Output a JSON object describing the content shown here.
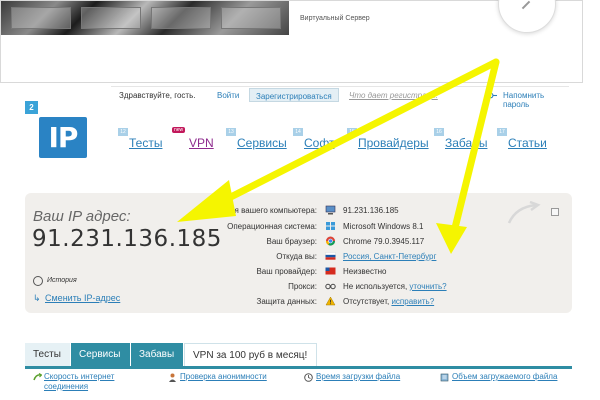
{
  "ad": {
    "caption": "Виртуальный Сервер"
  },
  "login_bar": {
    "greeting": "Здравствуйте, гость.",
    "login": "Войти",
    "register": "Зарегистрироваться",
    "what_gives": "Что дает регистрац...",
    "remind_password": "Напомнить пароль"
  },
  "logo": {
    "badge": "2",
    "text": "IP"
  },
  "nav": {
    "items": [
      {
        "label": "Тесты",
        "num": "12"
      },
      {
        "label": "VPN",
        "num": "",
        "badge": "new"
      },
      {
        "label": "Сервисы",
        "num": "13"
      },
      {
        "label": "Софт",
        "num": "14"
      },
      {
        "label": "Провайдеры",
        "num": "15"
      },
      {
        "label": "Забаны",
        "num": "16"
      },
      {
        "label": "Статьи",
        "num": "17"
      }
    ]
  },
  "ip_panel": {
    "label": "Ваш IP адрес:",
    "ip": "91.231.136.185",
    "history": "История",
    "change": "Сменить IP-адрес",
    "rows": [
      {
        "label": "Имя вашего компьютера:",
        "value": "91.231.136.185",
        "link": ""
      },
      {
        "label": "Операционная система:",
        "value": "Microsoft Windows 8.1",
        "link": ""
      },
      {
        "label": "Ваш браузер:",
        "value": "Chrome 79.0.3945.117",
        "link": ""
      },
      {
        "label": "Откуда вы:",
        "value": "",
        "link": "Россия, Санкт-Петербург"
      },
      {
        "label": "Ваш провайдер:",
        "value": "Неизвестно",
        "link": ""
      },
      {
        "label": "Прокси:",
        "value": "Не используется, ",
        "link": "уточнить?"
      },
      {
        "label": "Защита данных:",
        "value": "Отсутствует, ",
        "link": "исправить?"
      }
    ]
  },
  "tabs": {
    "items": [
      "Тесты",
      "Сервисы",
      "Забавы",
      "VPN за 100 руб в месяц!"
    ]
  },
  "services": {
    "items": [
      "Скорость интернет соединения",
      "Проверка анонимности",
      "Время загрузки файла",
      "Объем загружаемого файла"
    ]
  },
  "colors": {
    "accent": "#2c7fb8",
    "logo": "#2a83c4",
    "tab": "#2f8da3",
    "panel": "#f1efec",
    "annotation": "#f5f500"
  }
}
